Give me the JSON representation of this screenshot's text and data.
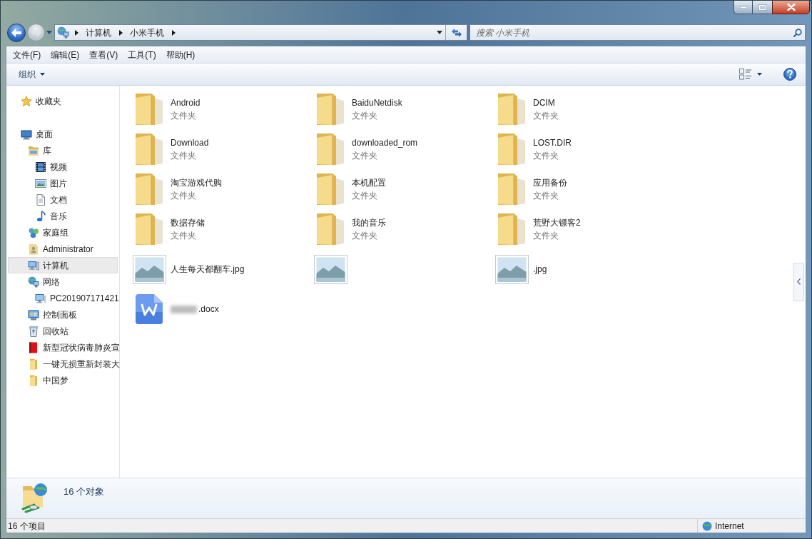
{
  "window": {
    "caption_buttons": [
      {
        "kind": "minimize"
      },
      {
        "kind": "maximize"
      },
      {
        "kind": "close"
      }
    ]
  },
  "forward_button": {
    "disabled": true
  },
  "address_bar": {
    "path": [
      "计算机",
      "小米手机"
    ]
  },
  "search": {
    "placeholder": "搜索 小米手机"
  },
  "menu_bar": [
    "文件(F)",
    "编辑(E)",
    "查看(V)",
    "工具(T)",
    "帮助(H)"
  ],
  "toolbar": {
    "organize": "组织"
  },
  "sidebar": {
    "items": [
      {
        "label": "收藏夹",
        "kind": "favorites",
        "selected": false
      },
      {
        "label": "桌面",
        "kind": "desktop",
        "selected": false,
        "children": [
          {
            "label": "库",
            "kind": "library",
            "selected": false,
            "children": [
              {
                "label": "视频",
                "kind": "video",
                "selected": false
              },
              {
                "label": "图片",
                "kind": "picture",
                "selected": false
              },
              {
                "label": "文档",
                "kind": "document",
                "selected": false
              },
              {
                "label": "音乐",
                "kind": "music",
                "selected": false
              }
            ]
          },
          {
            "label": "家庭组",
            "kind": "homegroup",
            "selected": false
          },
          {
            "label": "Administrator",
            "kind": "user",
            "selected": false
          },
          {
            "label": "计算机",
            "kind": "computer",
            "selected": true
          },
          {
            "label": "网络",
            "kind": "network",
            "selected": false,
            "children": [
              {
                "label": "PC201907171421",
                "kind": "pc",
                "selected": false
              }
            ]
          },
          {
            "label": "控制面板",
            "kind": "control",
            "selected": false
          },
          {
            "label": "回收站",
            "kind": "recycle",
            "selected": false
          },
          {
            "label": "新型冠状病毒肺炎宣",
            "kind": "book",
            "selected": false
          },
          {
            "label": "一键无损重新封装大",
            "kind": "folder",
            "selected": false
          },
          {
            "label": "中国梦",
            "kind": "folder",
            "selected": false
          }
        ]
      }
    ]
  },
  "files": [
    {
      "kind": "folder",
      "name": "Android",
      "type": "文件夹"
    },
    {
      "kind": "folder",
      "name": "BaiduNetdisk",
      "type": "文件夹"
    },
    {
      "kind": "folder",
      "name": "DCIM",
      "type": "文件夹"
    },
    {
      "kind": "folder",
      "name": "Download",
      "type": "文件夹"
    },
    {
      "kind": "folder",
      "name": "downloaded_rom",
      "type": "文件夹"
    },
    {
      "kind": "folder",
      "name": "LOST.DIR",
      "type": "文件夹"
    },
    {
      "kind": "folder",
      "name": "淘宝游戏代购",
      "type": "文件夹"
    },
    {
      "kind": "folder",
      "name": "本机配置",
      "type": "文件夹"
    },
    {
      "kind": "folder",
      "name": "应用备份",
      "type": "文件夹"
    },
    {
      "kind": "folder",
      "name": "数据存储",
      "type": "文件夹"
    },
    {
      "kind": "folder",
      "name": "我的音乐",
      "type": "文件夹"
    },
    {
      "kind": "folder",
      "name": "荒野大镖客2",
      "type": "文件夹"
    },
    {
      "kind": "image",
      "name": "人生每天都翻车.jpg"
    },
    {
      "kind": "image"
    },
    {
      "kind": "image",
      "name": ".jpg"
    },
    {
      "kind": "document",
      "name": ".docx",
      "blurred": true
    }
  ],
  "details_pane": {
    "summary": "16 个对象"
  },
  "status_bar": {
    "count": "16 个项目",
    "zone": "Internet"
  }
}
